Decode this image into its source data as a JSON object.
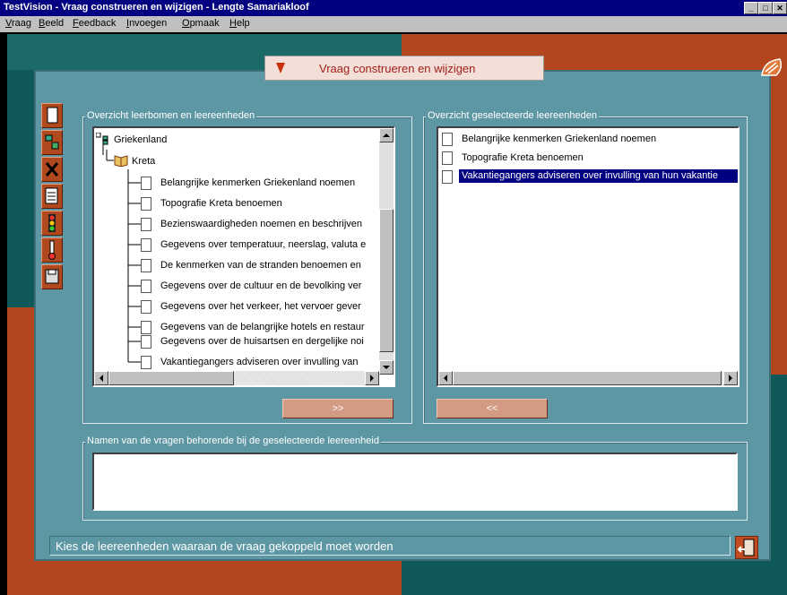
{
  "window": {
    "title": "TestVision - Vraag construeren en wijzigen - Lengte Samariakloof"
  },
  "menu": [
    "Vraag",
    "Beeld",
    "Feedback",
    "Invoegen",
    "Opmaak",
    "Help"
  ],
  "banner": {
    "text": "Vraag construeren en wijzigen"
  },
  "left_group": {
    "legend": "Overzicht leerbomen en leereenheden",
    "root": "Griekenland",
    "child": "Kreta",
    "items": [
      "Belangrijke kenmerken Griekenland noemen",
      "Topografie Kreta benoemen",
      "Bezienswaardigheden noemen en beschrijven",
      "Gegevens over temperatuur, neerslag, valuta e",
      "De kenmerken van de stranden benoemen en",
      "Gegevens over de cultuur en de bevolking ver",
      "Gegevens over het verkeer, het vervoer gever",
      "Gegevens van de belangrijke hotels en restaur",
      "Gegevens over de huisartsen en dergelijke noi",
      "Vakantiegangers adviseren over invulling van"
    ]
  },
  "right_group": {
    "legend": "Overzicht geselecteerde leereenheden",
    "items": [
      "Belangrijke kenmerken Griekenland noemen",
      "Topografie Kreta benoemen",
      "Vakantiegangers adviseren over invulling van hun vakantie"
    ]
  },
  "add_button": ">>",
  "remove_button": "<<",
  "bottom_group": {
    "legend": "Namen van de vragen behorende bij de geselecteerde leereenheid"
  },
  "status": {
    "text": "Kies de leereenheden waaraan de vraag gekoppeld moet worden"
  },
  "colors": {
    "title_bar": "#000080",
    "panel": "#5d97a3",
    "accent_red": "#b3451f",
    "teal": "#0f5a58",
    "button": "#d39a84"
  }
}
